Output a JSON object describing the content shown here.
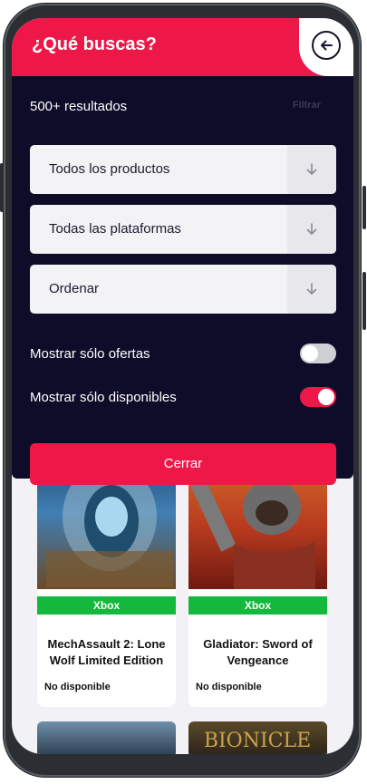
{
  "header": {
    "title": "¿Qué buscas?"
  },
  "filters": {
    "results": "500+ resultados",
    "filter_button": "Filtrar",
    "selects": [
      {
        "label": "Todos los productos"
      },
      {
        "label": "Todas las plataformas"
      },
      {
        "label": "Ordenar"
      }
    ],
    "toggles": [
      {
        "label": "Mostrar sólo ofertas",
        "on": false
      },
      {
        "label": "Mostrar sólo disponibles",
        "on": true
      }
    ],
    "close_button": "Cerrar"
  },
  "products": [
    {
      "platform": "Xbox",
      "title": "MechAssault 2: Lone Wolf Limited Edition",
      "status": "No disponible"
    },
    {
      "platform": "Xbox",
      "title": "Gladiator: Sword of Vengeance",
      "status": "No disponible"
    }
  ],
  "colors": {
    "accent": "#ee1848",
    "overlay": "#0f0c2a",
    "platform_xbox": "#14b83c"
  }
}
